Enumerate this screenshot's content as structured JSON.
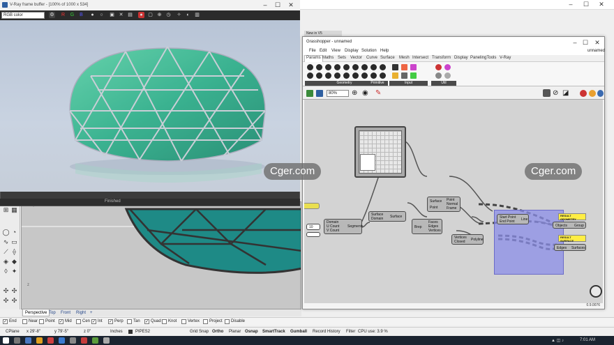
{
  "vray": {
    "title": "V-Ray frame buffer - [100% of 1000 x 534]",
    "channel": "RGB color",
    "status": "Finished"
  },
  "gh": {
    "title": "Grasshopper - unnamed",
    "doc_name": "unnamed",
    "menus": [
      "File",
      "Edit",
      "View",
      "Display",
      "Solution",
      "Help"
    ],
    "tabs": [
      "Params",
      "Maths",
      "Sets",
      "Vector",
      "Curve",
      "Surface",
      "Mesh",
      "Intersect",
      "Transform",
      "Display",
      "PanelingTools",
      "V-Ray"
    ],
    "groups": [
      "Geometry",
      "Primitive",
      "Input",
      "Util"
    ],
    "zoom": "80%",
    "version": "0.9.0076",
    "nodes": {
      "domain2": {
        "outputs": [
          "U Count",
          "V Count"
        ],
        "title": "Domain",
        "right": "Segments"
      },
      "srf_top": {
        "left": [
          "Surface",
          "Domain"
        ],
        "right": "Surface"
      },
      "eval": {
        "left": [
          "Surface",
          "Point"
        ],
        "right": [
          "Point",
          "Normal",
          "Frame"
        ]
      },
      "dbrep": {
        "left": "Brep",
        "right": [
          "Faces",
          "Edges",
          "Vertices"
        ]
      },
      "polyline": {
        "left": [
          "Vertices",
          "Closed"
        ],
        "right": "Polyline"
      },
      "line": {
        "left": [
          "Start Point",
          "End Point"
        ],
        "right": "Line"
      },
      "group1": {
        "left": "Objects",
        "right": "Group"
      },
      "group2": {
        "left": "Edges",
        "right": "Surfaces"
      },
      "slider_val": "10"
    },
    "panels": [
      "RESULT\nGEOMETRY",
      "RESULT\nSURFACE"
    ]
  },
  "new_in_v5": "New in V5",
  "watermark": "Cger.com",
  "viewport": {
    "label": "Perspective",
    "tabs": [
      "Perspective",
      "Top",
      "Front",
      "Right"
    ]
  },
  "osnaps": [
    {
      "label": "End",
      "checked": true
    },
    {
      "label": "Near",
      "checked": false
    },
    {
      "label": "Point",
      "checked": false
    },
    {
      "label": "Mid",
      "checked": true
    },
    {
      "label": "Cen",
      "checked": false
    },
    {
      "label": "Int",
      "checked": true
    },
    {
      "label": "Perp",
      "checked": true
    },
    {
      "label": "Tan",
      "checked": false
    },
    {
      "label": "Quad",
      "checked": true
    },
    {
      "label": "Knot",
      "checked": false
    },
    {
      "label": "Vertex",
      "checked": false
    },
    {
      "label": "Project",
      "checked": false
    },
    {
      "label": "Disable",
      "checked": false
    }
  ],
  "status": {
    "cplane": "CPlane",
    "x": "x 29'-8\"",
    "y": "y 79'-5\"",
    "z": "z 0\"",
    "units": "Inches",
    "layer": "PIPES2",
    "grid_snap": "Grid Snap",
    "ortho": "Ortho",
    "planar": "Planar",
    "osnap": "Osnap",
    "smarttrack": "SmartTrack",
    "gumball": "Gumball",
    "history": "Record History",
    "filter": "Filter",
    "cpu": "CPU use: 3.9 %"
  },
  "clock": "7:01 AM",
  "colors": {
    "panel_yellow": "#ffee44",
    "glass": "#2fb08a",
    "selection_blue": "#8b8ee8"
  }
}
